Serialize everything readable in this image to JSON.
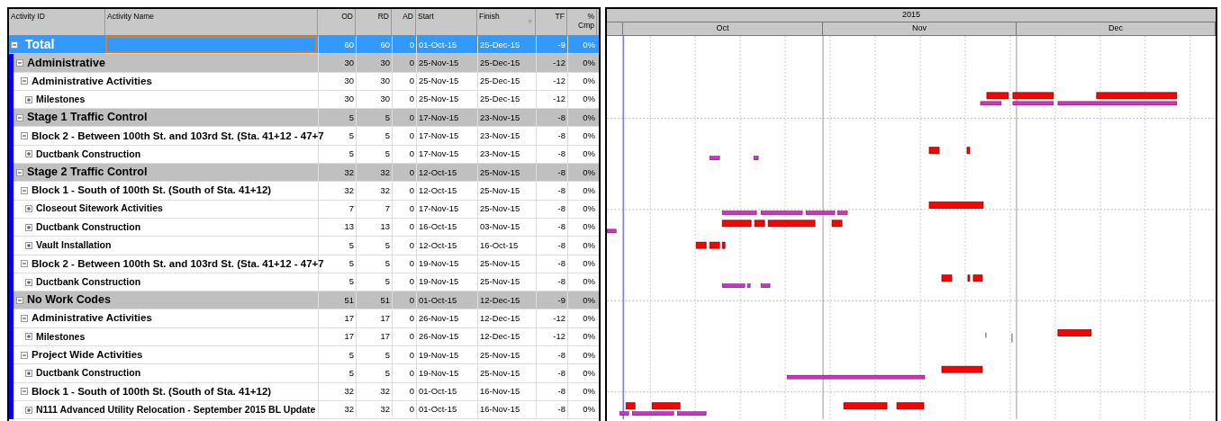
{
  "table": {
    "columns": [
      "Activity ID",
      "Activity Name",
      "OD",
      "RD",
      "AD",
      "Start",
      "Finish",
      "TF",
      "%\nCmp"
    ],
    "rows": [
      {
        "kind": "total",
        "name": "Total",
        "expanded": true,
        "selected": true,
        "od": "60",
        "rd": "60",
        "ad": "0",
        "start": "01-Oct-15",
        "finish": "25-Dec-15",
        "tf": "-9",
        "cmp": "0%",
        "children": [
          {
            "kind": "band",
            "name": "Administrative",
            "expanded": true,
            "selected": false,
            "od": "30",
            "rd": "30",
            "ad": "0",
            "start": "25-Nov-15",
            "finish": "25-Dec-15",
            "tf": "-12",
            "cmp": "0%",
            "children": [
              {
                "kind": "heading",
                "name": "Administrative Activities",
                "expanded": true,
                "selected": false,
                "od": "30",
                "rd": "30",
                "ad": "0",
                "start": "25-Nov-15",
                "finish": "25-Dec-15",
                "tf": "-12",
                "cmp": "0%",
                "children": [
                  {
                    "kind": "activity",
                    "name": "Milestones",
                    "expanded": false,
                    "selected": false,
                    "od": "30",
                    "rd": "30",
                    "ad": "0",
                    "start": "25-Nov-15",
                    "finish": "25-Dec-15",
                    "tf": "-12",
                    "cmp": "0%"
                  }
                ]
              }
            ]
          },
          {
            "kind": "band",
            "name": "Stage 1 Traffic Control",
            "expanded": true,
            "selected": false,
            "od": "5",
            "rd": "5",
            "ad": "0",
            "start": "17-Nov-15",
            "finish": "23-Nov-15",
            "tf": "-8",
            "cmp": "0%",
            "children": [
              {
                "kind": "heading",
                "name": "Block 2 - Between 100th St. and 103rd St. (Sta. 41+12 - 47+7",
                "expanded": true,
                "selected": false,
                "od": "5",
                "rd": "5",
                "ad": "0",
                "start": "17-Nov-15",
                "finish": "23-Nov-15",
                "tf": "-8",
                "cmp": "0%",
                "children": [
                  {
                    "kind": "activity",
                    "name": "Ductbank Construction",
                    "expanded": false,
                    "selected": false,
                    "od": "5",
                    "rd": "5",
                    "ad": "0",
                    "start": "17-Nov-15",
                    "finish": "23-Nov-15",
                    "tf": "-8",
                    "cmp": "0%"
                  }
                ]
              }
            ]
          },
          {
            "kind": "band",
            "name": "Stage 2 Traffic Control",
            "expanded": true,
            "selected": false,
            "od": "32",
            "rd": "32",
            "ad": "0",
            "start": "12-Oct-15",
            "finish": "25-Nov-15",
            "tf": "-8",
            "cmp": "0%",
            "children": [
              {
                "kind": "heading",
                "name": "Block 1 - South of 100th St. (South of Sta. 41+12)",
                "expanded": true,
                "selected": false,
                "od": "32",
                "rd": "32",
                "ad": "0",
                "start": "12-Oct-15",
                "finish": "25-Nov-15",
                "tf": "-8",
                "cmp": "0%",
                "children": [
                  {
                    "kind": "activity",
                    "name": "Closeout Sitework Activities",
                    "expanded": false,
                    "selected": false,
                    "od": "7",
                    "rd": "7",
                    "ad": "0",
                    "start": "17-Nov-15",
                    "finish": "25-Nov-15",
                    "tf": "-8",
                    "cmp": "0%"
                  },
                  {
                    "kind": "activity",
                    "name": "Ductbank Construction",
                    "expanded": false,
                    "selected": false,
                    "od": "13",
                    "rd": "13",
                    "ad": "0",
                    "start": "16-Oct-15",
                    "finish": "03-Nov-15",
                    "tf": "-8",
                    "cmp": "0%"
                  },
                  {
                    "kind": "activity",
                    "name": "Vault Installation",
                    "expanded": false,
                    "selected": false,
                    "od": "5",
                    "rd": "5",
                    "ad": "0",
                    "start": "12-Oct-15",
                    "finish": "16-Oct-15",
                    "tf": "-8",
                    "cmp": "0%"
                  }
                ]
              },
              {
                "kind": "heading",
                "name": "Block 2 - Between 100th St. and 103rd St. (Sta. 41+12 - 47+7",
                "expanded": true,
                "selected": false,
                "od": "5",
                "rd": "5",
                "ad": "0",
                "start": "19-Nov-15",
                "finish": "25-Nov-15",
                "tf": "-8",
                "cmp": "0%",
                "children": [
                  {
                    "kind": "activity",
                    "name": "Ductbank Construction",
                    "expanded": false,
                    "selected": false,
                    "od": "5",
                    "rd": "5",
                    "ad": "0",
                    "start": "19-Nov-15",
                    "finish": "25-Nov-15",
                    "tf": "-8",
                    "cmp": "0%"
                  }
                ]
              }
            ]
          },
          {
            "kind": "band",
            "name": "No Work Codes",
            "expanded": true,
            "selected": false,
            "od": "51",
            "rd": "51",
            "ad": "0",
            "start": "01-Oct-15",
            "finish": "12-Dec-15",
            "tf": "-9",
            "cmp": "0%",
            "children": [
              {
                "kind": "heading",
                "name": "Administrative Activities",
                "expanded": true,
                "selected": false,
                "od": "17",
                "rd": "17",
                "ad": "0",
                "start": "26-Nov-15",
                "finish": "12-Dec-15",
                "tf": "-12",
                "cmp": "0%",
                "children": [
                  {
                    "kind": "activity",
                    "name": "Milestones",
                    "expanded": false,
                    "selected": false,
                    "od": "17",
                    "rd": "17",
                    "ad": "0",
                    "start": "26-Nov-15",
                    "finish": "12-Dec-15",
                    "tf": "-12",
                    "cmp": "0%"
                  }
                ]
              },
              {
                "kind": "heading",
                "name": "Project Wide Activities",
                "expanded": true,
                "selected": false,
                "od": "5",
                "rd": "5",
                "ad": "0",
                "start": "19-Nov-15",
                "finish": "25-Nov-15",
                "tf": "-8",
                "cmp": "0%",
                "children": [
                  {
                    "kind": "activity",
                    "name": "Ductbank Construction",
                    "expanded": false,
                    "selected": false,
                    "od": "5",
                    "rd": "5",
                    "ad": "0",
                    "start": "19-Nov-15",
                    "finish": "25-Nov-15",
                    "tf": "-8",
                    "cmp": "0%"
                  }
                ]
              },
              {
                "kind": "heading",
                "name": "Block 1 - South of 100th St. (South of Sta. 41+12)",
                "expanded": true,
                "selected": false,
                "od": "32",
                "rd": "32",
                "ad": "0",
                "start": "01-Oct-15",
                "finish": "16-Nov-15",
                "tf": "-8",
                "cmp": "0%",
                "children": [
                  {
                    "kind": "activity",
                    "name": "N111 Advanced Utility Relocation - September 2015 BL Update",
                    "expanded": false,
                    "selected": false,
                    "od": "32",
                    "rd": "32",
                    "ad": "0",
                    "start": "01-Oct-15",
                    "finish": "16-Nov-15",
                    "tf": "-8",
                    "cmp": "0%"
                  }
                ]
              }
            ]
          }
        ]
      }
    ]
  },
  "gantt": {
    "year": "2015",
    "months": [
      "Oct",
      "Nov",
      "Dec"
    ]
  }
}
